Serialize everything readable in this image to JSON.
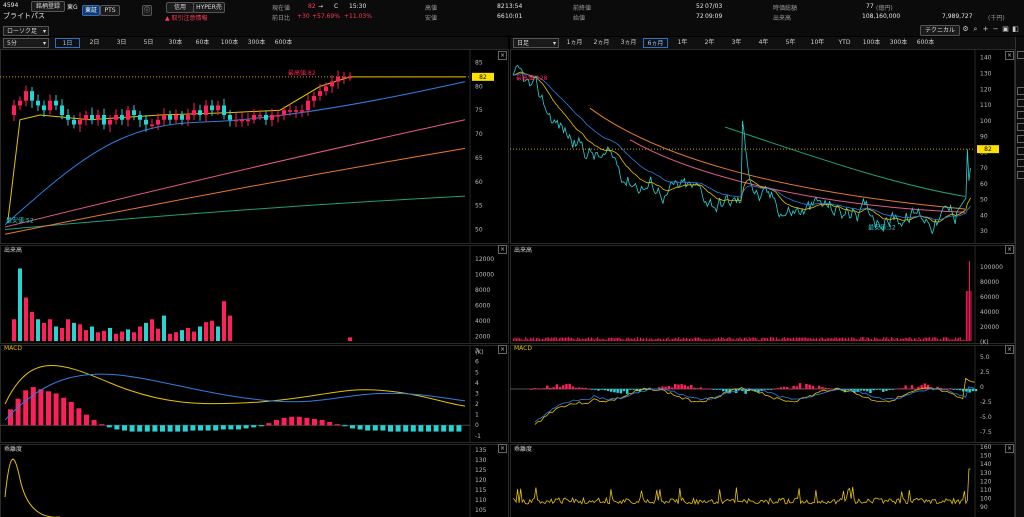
{
  "header": {
    "code": "4594",
    "name": "ブライトパス",
    "btn_register": "銘柄登録",
    "market": "東G",
    "tab_tosho": "東証",
    "tab_pts": "PTS",
    "credit": "信用",
    "hyper": "HYPER売",
    "warning": "取引注意情報",
    "current_price_label": "現在値",
    "current_price": "82",
    "arrow": "→",
    "c_flag": "C",
    "time": "15:30",
    "prev_ratio_label": "前日比",
    "change": "+30",
    "change_pct1": "+57.69%",
    "change_pct2": "+11.03%",
    "high_label": "高値",
    "high": "82",
    "high_time": "13:54",
    "low_label": "安値",
    "low": "66",
    "low_time": "10:01",
    "ytd_high_label": "前終値",
    "ytd_high": "52",
    "ytd_high_date": "07/03",
    "open_label": "始値",
    "open": "72",
    "open_time": "09:09",
    "mcap_label": "時価総額",
    "mcap": "77",
    "mcap_unit": "(億円)",
    "volume_label": "出来高",
    "volume": "108,160,000",
    "turnover": "7,989,727",
    "turnover_unit": "(千円)",
    "technical_btn": "テクニカル"
  },
  "left_panel": {
    "interval_select": "5分",
    "chart_type_select": "ローソク足",
    "tabs": [
      "1日",
      "2日",
      "3日",
      "5日",
      "30本",
      "60本",
      "100本",
      "300本",
      "600本"
    ],
    "active_tab": "1日",
    "price_axis": [
      "85",
      "80",
      "75",
      "70",
      "65",
      "60",
      "55",
      "50"
    ],
    "price_tag": "82",
    "max_label": "最高値:82",
    "min_label": "最安値:52",
    "volume_title": "出来高",
    "volume_axis": [
      "12000",
      "10000",
      "8000",
      "6000",
      "4000",
      "2000",
      "(K)"
    ],
    "macd_title": "MACD",
    "macd_axis": [
      "7",
      "6",
      "5",
      "4",
      "3",
      "2",
      "1",
      "0",
      "-1"
    ],
    "rsi_title": "乖離度",
    "rsi_axis": [
      "135",
      "130",
      "125",
      "120",
      "115",
      "110",
      "105"
    ]
  },
  "right_panel": {
    "interval_select": "日足",
    "tabs": [
      "1ヵ月",
      "2ヵ月",
      "3ヵ月",
      "6ヵ月",
      "1年",
      "2年",
      "3年",
      "4年",
      "5年",
      "10年",
      "YTD",
      "100本",
      "300本",
      "600本"
    ],
    "active_tab": "6ヵ月",
    "price_axis": [
      "140",
      "130",
      "120",
      "110",
      "100",
      "90",
      "80",
      "70",
      "60",
      "50",
      "40",
      "30"
    ],
    "price_tag": "82",
    "max_label": "最高値:128",
    "min_label": "最安値:32",
    "volume_title": "出来高",
    "volume_axis": [
      "100000",
      "80000",
      "60000",
      "40000",
      "20000",
      "(K)"
    ],
    "macd_title": "MACD",
    "macd_axis": [
      "5.0",
      "2.5",
      "0",
      "-2.5",
      "-5.0",
      "-7.5"
    ],
    "rsi_title": "乖離度",
    "rsi_axis": [
      "160",
      "150",
      "140",
      "130",
      "120",
      "110",
      "100",
      "90"
    ]
  },
  "colors": {
    "up": "#ff1f5a",
    "down": "#27d3d3",
    "ma_short": "#e6c200",
    "ma_mid": "#2f7fe0",
    "ma_long1": "#e65a8a",
    "ma_long2": "#e87a2a",
    "ma_long3": "#1fa07a",
    "price_tag": "#ffe100"
  },
  "icons": [
    "settings-icon",
    "search-icon",
    "zoom-in-icon",
    "zoom-out-icon",
    "expand-icon",
    "sidebar-icon"
  ]
}
